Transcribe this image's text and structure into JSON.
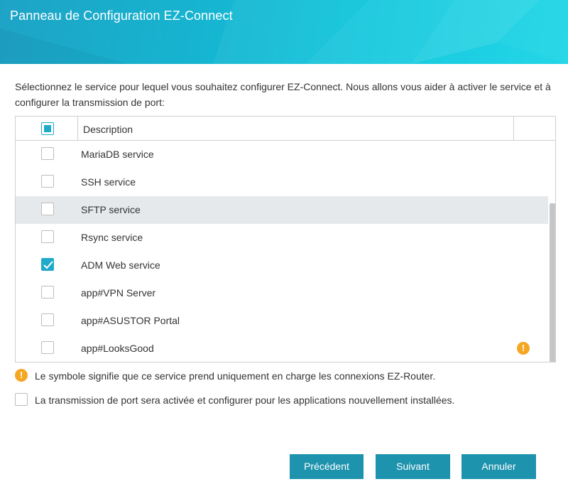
{
  "window": {
    "title": "Panneau de Configuration EZ-Connect"
  },
  "intro": "Sélectionnez le service pour lequel vous souhaitez configurer EZ-Connect. Nous allons vous aider à activer le service et à configurer la transmission de port:",
  "table": {
    "header": {
      "description": "Description",
      "select_all_state": "partial"
    },
    "rows": [
      {
        "label": "MariaDB service",
        "checked": false
      },
      {
        "label": "SSH service",
        "checked": false
      },
      {
        "label": "SFTP service",
        "checked": false,
        "highlighted": true
      },
      {
        "label": "Rsync service",
        "checked": false
      },
      {
        "label": "ADM Web service",
        "checked": true
      },
      {
        "label": "app#VPN Server",
        "checked": false
      },
      {
        "label": "app#ASUSTOR Portal",
        "checked": false
      },
      {
        "label": "app#LooksGood",
        "checked": false,
        "warning": true
      }
    ]
  },
  "warning_glyph": "!",
  "note": "Le symbole signifie que ce service prend uniquement en charge les connexions EZ-Router.",
  "auto_forward_option": {
    "label": "La transmission de port sera activée et configurer pour les applications nouvellement installées.",
    "checked": false
  },
  "buttons": {
    "previous": "Précédent",
    "next": "Suivant",
    "cancel": "Annuler"
  },
  "colors": {
    "accent": "#1faac9",
    "button": "#1e93ad",
    "warning": "#f5a623",
    "row_highlight": "#e6e9ec"
  }
}
